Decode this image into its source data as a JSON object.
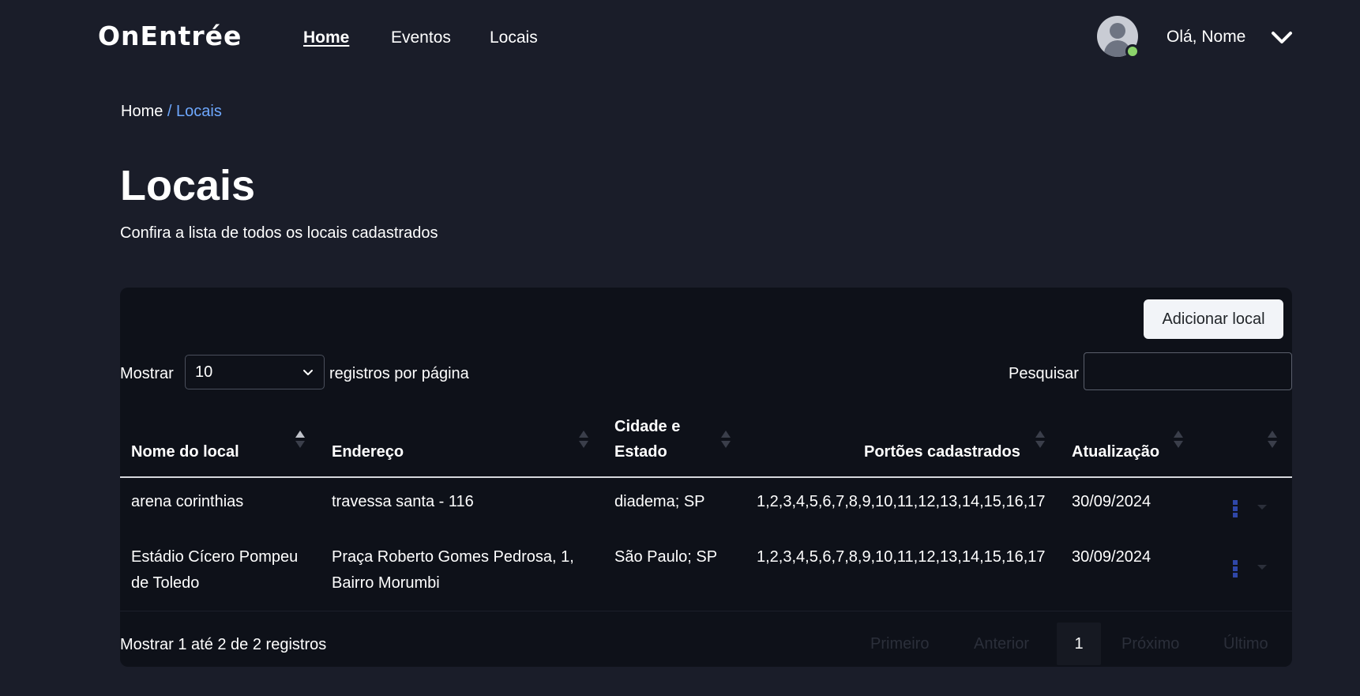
{
  "nav": {
    "logo": "OnEntrée",
    "links": [
      {
        "label": "Home",
        "active": true
      },
      {
        "label": "Eventos",
        "active": false
      },
      {
        "label": "Locais",
        "active": false
      }
    ],
    "greeting": "Olá, Nome",
    "status_color": "#8bd36a"
  },
  "breadcrumb": {
    "home": "Home",
    "current": "/ Locais"
  },
  "page": {
    "title": "Locais",
    "subtitle": "Confira a lista de todos os locais cadastrados"
  },
  "toolbar": {
    "add_button": "Adicionar local",
    "length_prefix": "Mostrar",
    "length_value": "10",
    "length_suffix": "registros por página",
    "search_label": "Pesquisar",
    "search_value": ""
  },
  "table": {
    "headers": {
      "nome": "Nome do local",
      "endereco": "Endereço",
      "cidade_line1": "Cidade e",
      "cidade_line2": "Estado",
      "portoes": "Portões cadastrados",
      "atualizacao": "Atualização"
    },
    "rows": [
      {
        "nome_l1": "arena corinthias",
        "nome_l2": "",
        "endereco_l1": "travessa santa - 116",
        "endereco_l2": "",
        "cidade": "diadema; SP",
        "portoes": "1,2,3,4,5,6,7,8,9,10,11,12,13,14,15,16,17",
        "atualizacao": "30/09/2024"
      },
      {
        "nome_l1": "Estádio Cícero Pompeu",
        "nome_l2": "de Toledo",
        "endereco_l1": "Praça Roberto Gomes Pedrosa, 1,",
        "endereco_l2": "Bairro Morumbi",
        "cidade": "São Paulo; SP",
        "portoes": "1,2,3,4,5,6,7,8,9,10,11,12,13,14,15,16,17",
        "atualizacao": "30/09/2024"
      }
    ]
  },
  "footer": {
    "info": "Mostrar 1 até 2 de 2 registros",
    "pagination": {
      "first": "Primeiro",
      "previous": "Anterior",
      "current": "1",
      "next": "Próximo",
      "last": "Último"
    }
  }
}
